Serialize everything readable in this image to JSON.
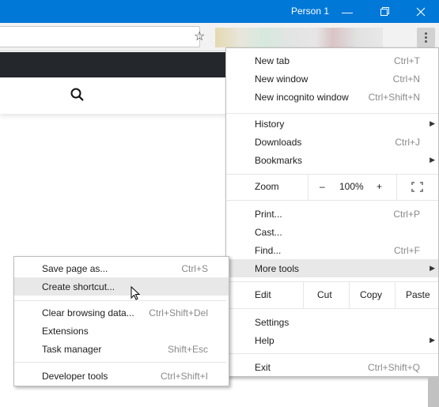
{
  "titlebar": {
    "profile_name": "Person 1",
    "minimize_icon": "—",
    "restore_icon": "❐",
    "close_icon": "✕",
    "color": "#0078d7"
  },
  "toolbar": {
    "bookmark_star_icon": "☆"
  },
  "main_menu": {
    "items": [
      {
        "label": "New tab",
        "shortcut": "Ctrl+T"
      },
      {
        "label": "New window",
        "shortcut": "Ctrl+N"
      },
      {
        "label": "New incognito window",
        "shortcut": "Ctrl+Shift+N"
      },
      {
        "label": "History",
        "submenu_arrow": "▶"
      },
      {
        "label": "Downloads",
        "shortcut": "Ctrl+J"
      },
      {
        "label": "Bookmarks",
        "submenu_arrow": "▶"
      },
      {
        "label": "Print...",
        "shortcut": "Ctrl+P"
      },
      {
        "label": "Cast..."
      },
      {
        "label": "Find...",
        "shortcut": "Ctrl+F"
      },
      {
        "label": "More tools",
        "submenu_arrow": "▶"
      },
      {
        "label": "Settings"
      },
      {
        "label": "Help",
        "submenu_arrow": "▶"
      },
      {
        "label": "Exit",
        "shortcut": "Ctrl+Shift+Q"
      }
    ],
    "zoom": {
      "label": "Zoom",
      "minus": "–",
      "value": "100%",
      "plus": "+"
    },
    "edit": {
      "label": "Edit",
      "cut": "Cut",
      "copy": "Copy",
      "paste": "Paste"
    }
  },
  "more_tools_menu": {
    "items": [
      {
        "label": "Save page as...",
        "shortcut": "Ctrl+S"
      },
      {
        "label": "Create shortcut..."
      },
      {
        "label": "Clear browsing data...",
        "shortcut": "Ctrl+Shift+Del"
      },
      {
        "label": "Extensions"
      },
      {
        "label": "Task manager",
        "shortcut": "Shift+Esc"
      },
      {
        "label": "Developer tools",
        "shortcut": "Ctrl+Shift+I"
      }
    ]
  }
}
